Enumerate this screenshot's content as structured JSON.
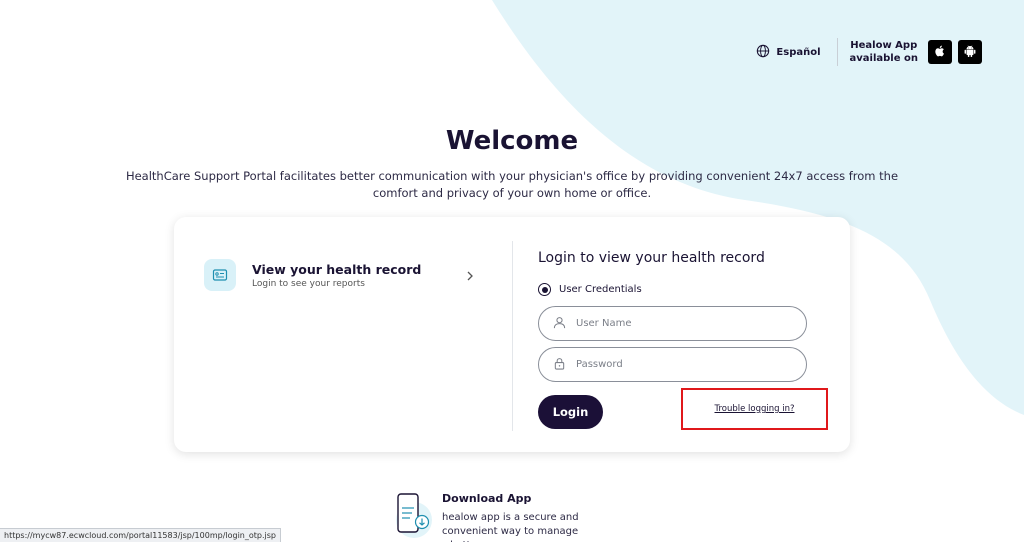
{
  "header": {
    "language_label": "Español",
    "app_line1": "Healow App",
    "app_line2": "available on",
    "icons": [
      "globe-icon",
      "apple-icon",
      "android-icon"
    ]
  },
  "welcome": {
    "title": "Welcome",
    "intro": "HealthCare Support Portal facilitates better communication with your physician's office by providing convenient 24x7 access from the comfort and privacy of your own home or office."
  },
  "health_record_option": {
    "title": "View your health record",
    "subtitle": "Login to see your reports"
  },
  "login": {
    "title": "Login to view your health record",
    "radio_label": "User Credentials",
    "username_placeholder": "User Name",
    "password_placeholder": "Password",
    "login_button": "Login",
    "trouble_link": "Trouble logging in?"
  },
  "download": {
    "title": "Download App",
    "description": "healow app is a secure and convenient way to manage what's"
  },
  "status_bar": {
    "url": "https://mycw87.ecwcloud.com/portal11583/jsp/100mp/login_otp.jsp"
  },
  "colors": {
    "accent_dark": "#1b1037",
    "bg_blob": "#e2f4f9",
    "highlight_border": "#e0181b"
  }
}
